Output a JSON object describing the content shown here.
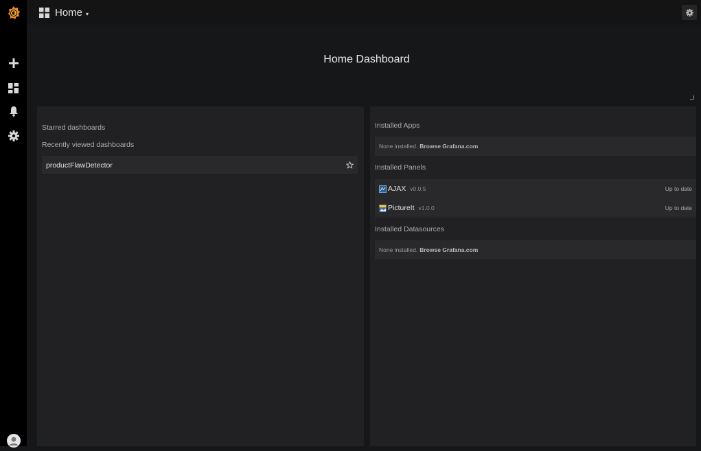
{
  "sidebar": {
    "items": [
      {
        "icon": "grafana-logo-icon"
      },
      {
        "icon": "plus-icon"
      },
      {
        "icon": "dashboards-icon"
      },
      {
        "icon": "bell-icon"
      },
      {
        "icon": "gear-icon"
      },
      {
        "icon": "user-avatar-icon"
      }
    ]
  },
  "topbar": {
    "home_label": "Home",
    "caret": "▾"
  },
  "header": {
    "title": "Home Dashboard"
  },
  "left_panel": {
    "starred_label": "Starred dashboards",
    "recent_label": "Recently viewed dashboards",
    "recent": [
      {
        "name": "productFlawDetector"
      }
    ]
  },
  "right_panel": {
    "apps_label": "Installed Apps",
    "apps_none": "None installed.",
    "apps_browse": "Browse Grafana.com",
    "panels_label": "Installed Panels",
    "panels": [
      {
        "name": "AJAX",
        "version": "v0.0.5",
        "status": "Up to date"
      },
      {
        "name": "PictureIt",
        "version": "v1.0.0",
        "status": "Up to date"
      }
    ],
    "datasources_label": "Installed Datasources",
    "ds_none": "None installed.",
    "ds_browse": "Browse Grafana.com"
  },
  "colors": {
    "brand_orange": "#f7941d",
    "background": "#161719",
    "panel": "#212124"
  }
}
